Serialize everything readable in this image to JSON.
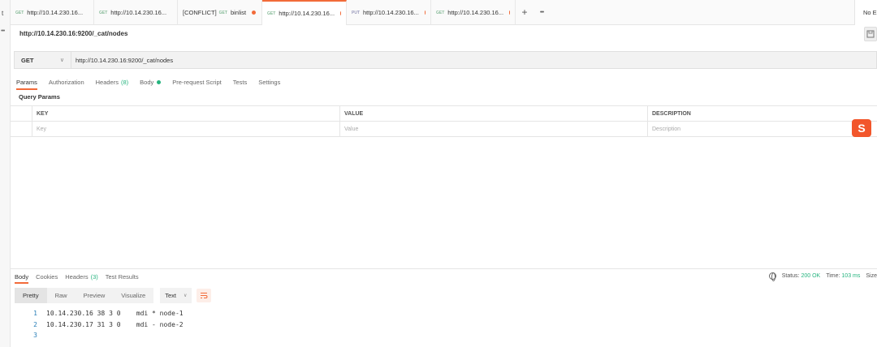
{
  "left_strip": {
    "label": "t",
    "more": "•••"
  },
  "tabs": [
    {
      "method": "GET",
      "title": "http://10.14.230.16...",
      "conflict": "",
      "active": false
    },
    {
      "method": "GET",
      "title": "http://10.14.230.16...",
      "conflict": "",
      "active": false
    },
    {
      "method": "GET",
      "title": "binlist",
      "conflict": "[CONFLICT]",
      "active": false
    },
    {
      "method": "GET",
      "title": "http://10.14.230.16...",
      "conflict": "",
      "active": true
    },
    {
      "method": "PUT",
      "title": "http://10.14.230.16...",
      "conflict": "",
      "active": false
    },
    {
      "method": "GET",
      "title": "http://10.14.230.16...",
      "conflict": "",
      "active": false
    }
  ],
  "tab_actions": {
    "add": "+",
    "more": "•••"
  },
  "environment": {
    "label": "No E"
  },
  "request": {
    "title": "http://10.14.230.16:9200/_cat/nodes",
    "method": "GET",
    "url": "http://10.14.230.16:9200/_cat/nodes"
  },
  "request_tabs": {
    "params": "Params",
    "authorization": "Authorization",
    "headers": "Headers",
    "headers_count": "(8)",
    "body": "Body",
    "prerequest": "Pre-request Script",
    "tests": "Tests",
    "settings": "Settings"
  },
  "query_params": {
    "title": "Query Params",
    "columns": [
      "KEY",
      "VALUE",
      "DESCRIPTION"
    ],
    "placeholders": [
      "Key",
      "Value",
      "Description"
    ]
  },
  "response_tabs": {
    "body": "Body",
    "cookies": "Cookies",
    "headers": "Headers",
    "headers_count": "(3)",
    "test_results": "Test Results"
  },
  "status": {
    "status_label": "Status:",
    "status_value": "200 OK",
    "time_label": "Time:",
    "time_value": "103 ms",
    "size_label": "Size"
  },
  "view_modes": {
    "pretty": "Pretty",
    "raw": "Raw",
    "preview": "Preview",
    "visualize": "Visualize"
  },
  "format": {
    "selected": "Text",
    "chevron": "∨"
  },
  "method_chevron": "∨",
  "response_lines": [
    {
      "num": "1",
      "text": "10.14.230.16 38 3 0    mdi * node-1"
    },
    {
      "num": "2",
      "text": "10.14.230.17 31 3 0    mdi - node-2"
    },
    {
      "num": "3",
      "text": ""
    }
  ],
  "colors": {
    "accent": "#f26b3a",
    "success": "#26b47f",
    "badge": "#f2562b"
  },
  "badge": {
    "glyph": "S"
  }
}
